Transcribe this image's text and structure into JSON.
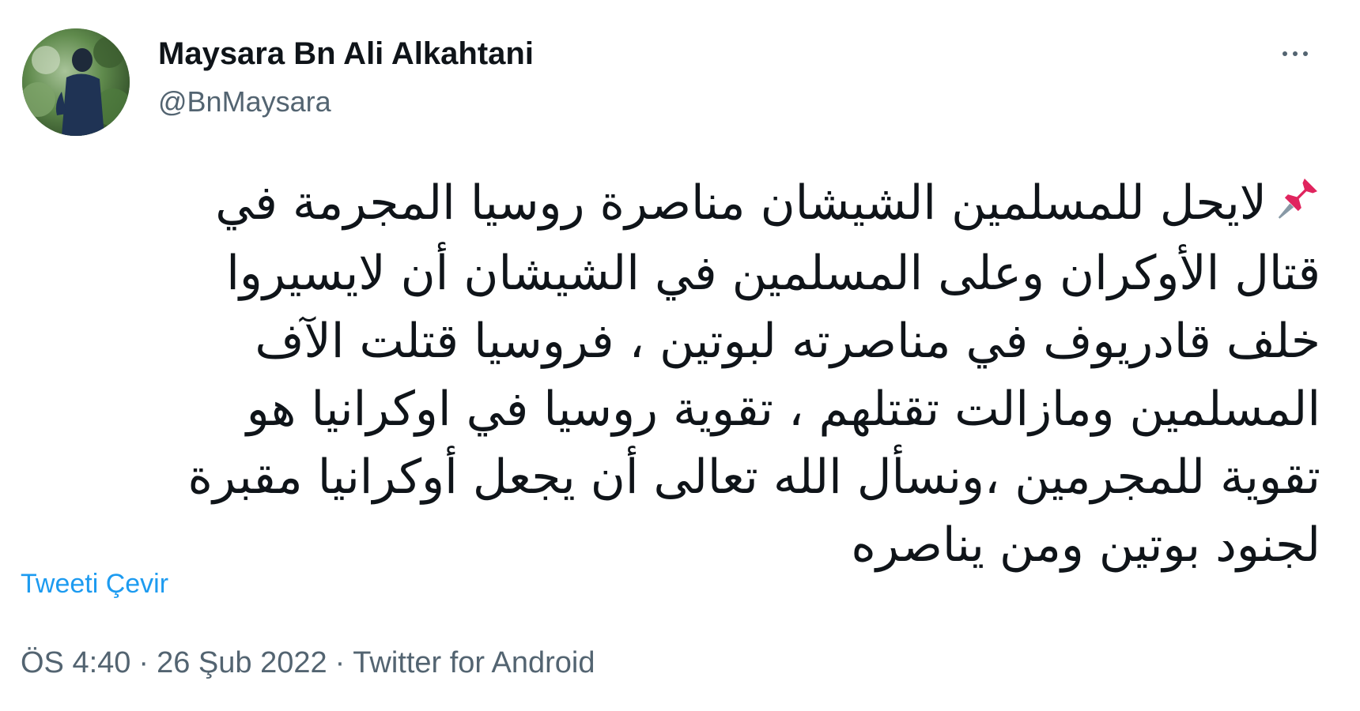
{
  "user": {
    "display_name": "Maysara Bn Ali Alkahtani",
    "handle": "@BnMaysara"
  },
  "tweet": {
    "pin_icon": "pushpin-icon",
    "lines": [
      "لايحل للمسلمين الشيشان مناصرة روسيا المجرمة في",
      "قتال الأوكران وعلى المسلمين في الشيشان أن لايسيروا",
      "خلف قادريوف في مناصرته لبوتين ، فروسيا قتلت الآف",
      "المسلمين ومازالت تقتلهم ، تقوية روسيا في اوكرانيا هو",
      "تقوية للمجرمين ،ونسأل الله تعالى أن يجعل أوكرانيا مقبرة",
      "لجنود بوتين ومن يناصره"
    ],
    "translate_label": "Tweeti Çevir"
  },
  "meta": {
    "time": "ÖS 4:40",
    "separator": "·",
    "date": "26 Şub 2022",
    "source": "Twitter for Android"
  },
  "colors": {
    "link": "#1d9bf0",
    "secondary": "#536471",
    "text": "#0f1419",
    "pin": "#e0245e"
  }
}
